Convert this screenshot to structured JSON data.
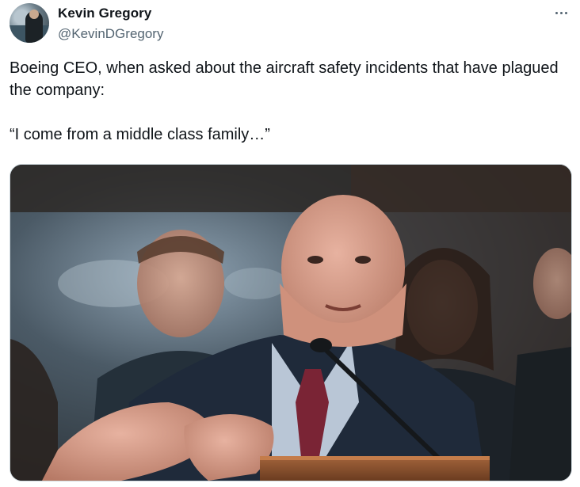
{
  "tweet": {
    "author": {
      "display_name": "Kevin Gregory",
      "handle": "@KevinDGregory",
      "avatar_icon": "avatar-photo"
    },
    "more_icon": "more-horizontal-icon",
    "text_lines": [
      "Boeing CEO, when asked about the aircraft safety incidents that have plagued the company:",
      "“I come from a middle class family…”"
    ],
    "media": {
      "kind": "photo"
    }
  },
  "colors": {
    "text_primary": "#0f1419",
    "text_secondary": "#536471",
    "border": "#cfd9de"
  }
}
